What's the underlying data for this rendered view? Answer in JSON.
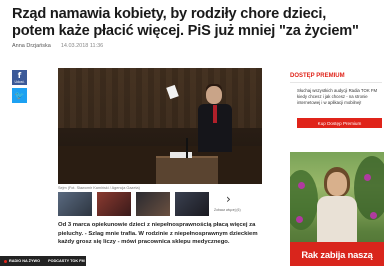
{
  "article": {
    "headline": "Rząd namawia kobiety, by rodziły chore dzieci, potem każe płacić więcej. PiS już mniej \"za życiem\"",
    "author": "Anna Drzjańska",
    "date": "14.03.2018 11:36",
    "photo_caption": "Sejm (Fot. Sławomir Kamiński / Agencja Gazeta)",
    "lead": "Od 3 marca opiekunowie dzieci z niepełnosprawnością płacą więcej za pieluchy. - Szlag mnie trafia. W rodzinie z niepełnosprawnym dzieckiem każdy grosz się liczy - mówi pracownica sklepu medycznego.",
    "more_photos_label": "Zobacz więcej (6)"
  },
  "share": {
    "facebook_glyph": "f",
    "facebook_label": "Udost.",
    "twitter_glyph": "🐦"
  },
  "promo": {
    "title": "DOSTĘP PREMIUM",
    "text": "Słuchaj wszystkich audycji Radia TOK FM kiedy chcesz i jak chcesz - na stronie internetowej i w aplikacji mobilnej!",
    "button": "Kup Dostęp Premium"
  },
  "ad": {
    "text": "Rak zabija naszą"
  },
  "bottom_bar": {
    "live": "RADIO NA ŻYWO",
    "podcasts": "PODCASTY TOK FM"
  },
  "colors": {
    "accent": "#e0241a",
    "facebook": "#3b5998",
    "twitter": "#1da1f2"
  }
}
